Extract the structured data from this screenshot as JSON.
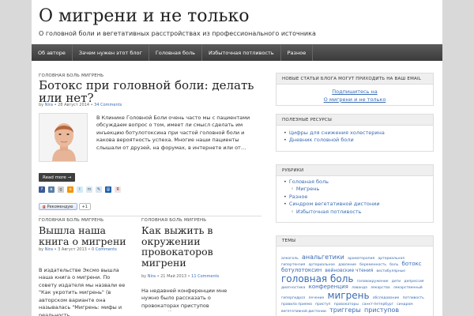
{
  "site": {
    "title": "О мигрени и не только",
    "description": "О головной боли и вегетативных расстройствах из профессионального источника"
  },
  "nav": [
    {
      "label": "Об авторе"
    },
    {
      "label": "Зачем нужен этот блог"
    },
    {
      "label": "Головная боль"
    },
    {
      "label": "Избыточная потливость"
    },
    {
      "label": "Разное"
    }
  ],
  "post1": {
    "categories": "ГОЛОВНАЯ БОЛЬ МИГРЕНЬ",
    "title": "Ботокс при головной боли: делать или нет?",
    "meta_by": "by",
    "author": "Nira",
    "date": "28 Август 2014",
    "comments": "34 Comments",
    "excerpt": "В Клинике Головной Боли очень часто мы с пациентами обсуждаем вопрос о том, имеет ли смысл сделать им инъекцию ботулотоксина при частой головной боли и какова вероятность успеха. Многие наши пациенты слышали от друзей, на форумах, в интернете или от…",
    "read_more": "Read more →",
    "plusone": "Рекомендую",
    "plusone_count": "+1"
  },
  "post2": {
    "categories": "ГОЛОВНАЯ БОЛЬ МИГРЕНЬ",
    "title": "Вышла наша книга о мигрени",
    "meta_by": "by",
    "author": "Nira",
    "date": "3 Август 2013",
    "comments": "0 Comments",
    "excerpt": "В издательстве Эксмо вышла наша книга о мигрени. По совету издателя мы назвали ее \"Как укротить мигрень\" (в авторском варианте она называлась \"Мигрень: мифы и реальность."
  },
  "post3": {
    "categories": "ГОЛОВНАЯ БОЛЬ МИГРЕНЬ",
    "title": "Как выжить в окружении провокаторов мигрени",
    "meta_by": "by",
    "author": "Nira",
    "date": "21 Май 2013",
    "comments": "11 Comments",
    "excerpt": "На недавней конференции мне нужно было рассказать о провокаторах приступов мигрени. И я подумала, что это как раз"
  },
  "sidebar": {
    "email_widget": {
      "title": "НОВЫЕ СТАТЬИ БЛОГА МОГУТ ПРИХОДИТЬ НА ВАШ EMAIL",
      "link1": "Подпишитесь на",
      "link2": "О мигрени и не только"
    },
    "resources": {
      "title": "ПОЛЕЗНЫЕ РЕСУРСЫ",
      "items": [
        "Цифры для снижения холестерина",
        "Дневник головной боли"
      ]
    },
    "rubrics": {
      "title": "РУБРИКИ",
      "items": [
        "Головная боль",
        "Мигрень",
        "Разное",
        "Синдром вегетативной дистонии"
      ],
      "sub_items": [
        "Избыточная потливость"
      ]
    },
    "tags": {
      "title": "ТЕМЫ",
      "list": [
        {
          "text": "алкоголь",
          "size": 4.5
        },
        {
          "text": "анальгетики",
          "size": 8
        },
        {
          "text": "ароматерапия",
          "size": 4.5
        },
        {
          "text": "артериальная гипертензия",
          "size": 4.5
        },
        {
          "text": "артериальное",
          "size": 4.5
        },
        {
          "text": "давление",
          "size": 4.5
        },
        {
          "text": "беременность",
          "size": 4.5
        },
        {
          "text": "боль",
          "size": 4.5
        },
        {
          "text": "ботокс",
          "size": 7
        },
        {
          "text": "ботулотоксин",
          "size": 7
        },
        {
          "text": "вейновские чтения",
          "size": 6
        },
        {
          "text": "вестибулярные",
          "size": 4.5
        },
        {
          "text": "головная боль",
          "size": 12
        },
        {
          "text": "головокружение",
          "size": 4.5
        },
        {
          "text": "дети",
          "size": 4.5
        },
        {
          "text": "депрессия",
          "size": 4.5
        },
        {
          "text": "диагностика",
          "size": 4.5
        },
        {
          "text": "конференция",
          "size": 7
        },
        {
          "text": "лаванда",
          "size": 4.5
        },
        {
          "text": "лекарства",
          "size": 4.5
        },
        {
          "text": "лекарственный гипергидроз",
          "size": 4.5
        },
        {
          "text": "лечение",
          "size": 4.5
        },
        {
          "text": "мигрень",
          "size": 12
        },
        {
          "text": "обследование",
          "size": 4.5
        },
        {
          "text": "потливость",
          "size": 4.5
        },
        {
          "text": "правила приема",
          "size": 4.5
        },
        {
          "text": "приступ",
          "size": 4.5
        },
        {
          "text": "провокаторы",
          "size": 4.5
        },
        {
          "text": "санкт-петербург",
          "size": 4.5
        },
        {
          "text": "синдром вегетативной дистонии",
          "size": 4.5
        },
        {
          "text": "триггеры",
          "size": 8
        },
        {
          "text": "приступов",
          "size": 8
        }
      ]
    }
  },
  "colors": {
    "link": "#3a6cb4",
    "nav_bg": "#4a4a4a",
    "page_bg": "#d9d9d9"
  }
}
